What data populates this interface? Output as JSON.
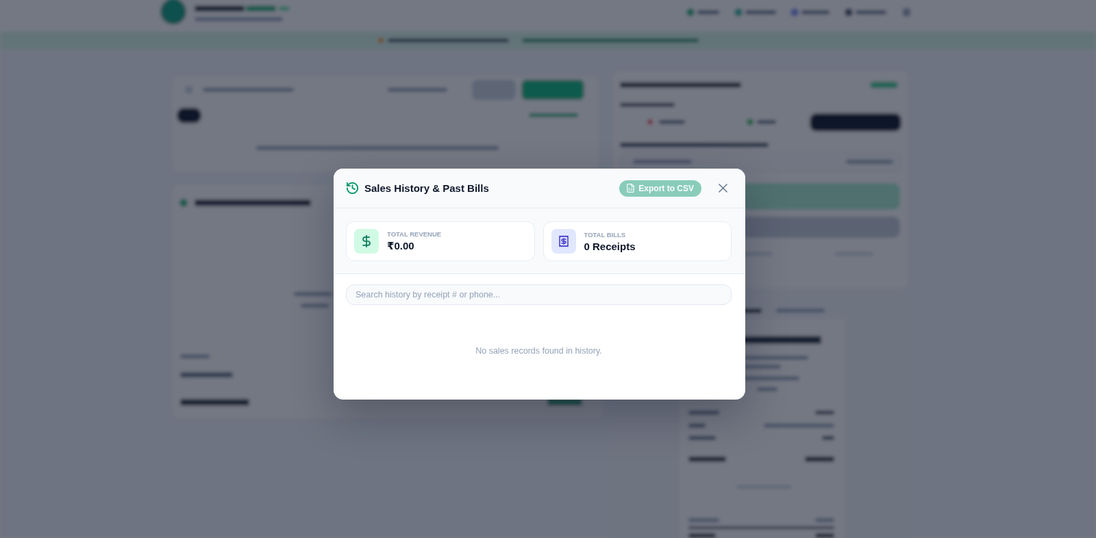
{
  "modal": {
    "title": "Sales History & Past Bills",
    "export_button": {
      "label": "Export to CSV",
      "disabled": true
    },
    "stats": [
      {
        "kind": "revenue",
        "label": "TOTAL REVENUE",
        "value": "₹0.00"
      },
      {
        "kind": "bills",
        "label": "TOTAL BILLS",
        "value": "0 Receipts"
      }
    ],
    "search": {
      "placeholder": "Search history by receipt # or phone..."
    },
    "empty_message": "No sales records found in history."
  }
}
